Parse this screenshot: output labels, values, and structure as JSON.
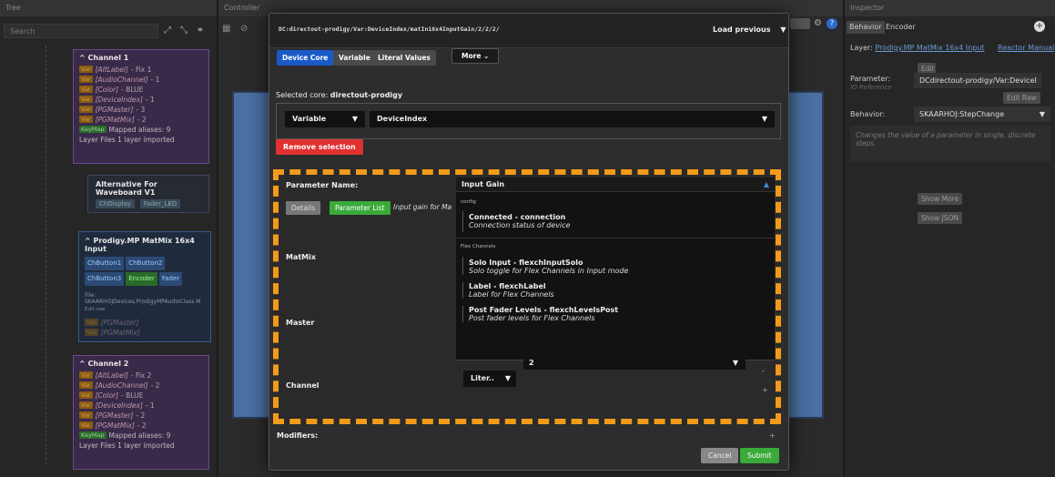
{
  "tree": {
    "title": "Tree",
    "search_placeholder": "Search",
    "channel1": {
      "title": "Channel 1",
      "aliases": [
        {
          "tag": "Var",
          "name": "[AltLabel]",
          "value": "- Fix 1"
        },
        {
          "tag": "Var",
          "name": "[AudioChannel]",
          "value": "- 1"
        },
        {
          "tag": "Var",
          "name": "[Color]",
          "value": "- BLUE"
        },
        {
          "tag": "Var",
          "name": "[DeviceIndex]",
          "value": "- 1"
        },
        {
          "tag": "Var",
          "name": "[PGMaster]",
          "value": "- 3"
        },
        {
          "tag": "Var",
          "name": "[PGMatMix]",
          "value": "- 2"
        }
      ],
      "keymap_tag": "KeyMap",
      "keymap_text": "Mapped aliases: 9",
      "layer_files": "Layer Files 1 layer imported"
    },
    "alt_node": {
      "title": "Alternative For Waveboard V1",
      "chips": [
        "ChDisplay",
        "Fader_LED"
      ]
    },
    "prodigy_node": {
      "title": "Prodigy.MP MatMix 16x4 Input",
      "chips": [
        "ChButton1",
        "ChButton2",
        "ChButton3",
        "Encoder",
        "Fader"
      ],
      "file_label": "File:",
      "file_path": "SKAARHOJDevices.ProdigyMPAudioClass.M",
      "edit_label": "Edit raw",
      "faded": [
        "[PGMaster]",
        "[PGMatMix]"
      ]
    },
    "channel2": {
      "title": "Channel 2",
      "aliases": [
        {
          "tag": "Var",
          "name": "[AltLabel]",
          "value": "- Fix 2"
        },
        {
          "tag": "Var",
          "name": "[AudioChannel]",
          "value": "- 2"
        },
        {
          "tag": "Var",
          "name": "[Color]",
          "value": "- BLUE"
        },
        {
          "tag": "Var",
          "name": "[DeviceIndex]",
          "value": "- 1"
        },
        {
          "tag": "Var",
          "name": "[PGMaster]",
          "value": "- 2"
        },
        {
          "tag": "Var",
          "name": "[PGMatMix]",
          "value": "- 2"
        }
      ],
      "keymap_tag": "KeyMap",
      "keymap_text": "Mapped aliases: 9",
      "layer_files": "Layer Files 1 layer imported"
    }
  },
  "controller": {
    "title": "Controller"
  },
  "inspector": {
    "title": "Inspector",
    "tab_behavior": "Behavior",
    "tab_encoder": "Encoder",
    "layer_label": "Layer:",
    "layer_link": "Prodigy.MP MatMix 16x4 Input",
    "reactor_link": "Reactor Manual",
    "edit_btn": "Edit",
    "parameter_label": "Parameter:",
    "io_reference": "IO Reference",
    "parameter_value": "DCdirectout-prodigy/Var:DeviceI",
    "edit_raw": "Edit Raw",
    "behavior_label": "Behavior:",
    "behavior_value": "SKAARHOJ:StepChange",
    "behavior_desc": "Changes the value of a parameter in single, discrete steps.",
    "show_more": "Show More",
    "show_json": "Show JSON"
  },
  "modal": {
    "path": "DC:directout-prodigy/Var:DeviceIndex/matIn16x4InputGain/2/2/2/",
    "load_previous": "Load previous",
    "tabs": {
      "device_core": "Device Core",
      "variable": "Variable",
      "literal_values": "Literal Values",
      "more": "More"
    },
    "selected_core_label": "Selected core:",
    "selected_core_value": "directout-prodigy",
    "dropdown_type": "Variable",
    "dropdown_value": "DeviceIndex",
    "remove_selection": "Remove selection",
    "param_name_label": "Parameter Name:",
    "details_btn": "Details",
    "param_list_btn": "Parameter List",
    "param_hint": "Input gain for Ma",
    "labels": {
      "matmix": "MatMix",
      "master": "Master",
      "channel": "Channel"
    },
    "param_selected": "Input Gain",
    "list": [
      {
        "category": "config"
      },
      {
        "title": "Connected - connection",
        "desc": "Connection status of device"
      },
      {
        "category": "Flex Channels"
      },
      {
        "title": "Solo Input - flexchInputSolo",
        "desc": "Solo toggle for Flex Channels in Input mode"
      },
      {
        "title": "Label - flexchLabel",
        "desc": "Label for Flex Channels"
      },
      {
        "title": "Post Fader Levels - flexchLevelsPost",
        "desc": "Post fader levels for Flex Channels"
      }
    ],
    "channel_value": "2",
    "liter_label": "Liter..",
    "modifiers": "Modifiers:",
    "cancel": "Cancel",
    "submit": "Submit"
  }
}
